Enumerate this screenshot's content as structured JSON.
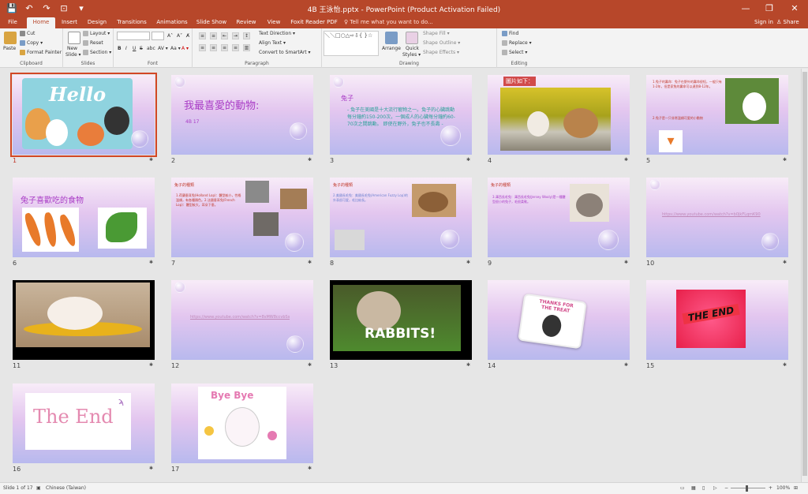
{
  "titlebar": {
    "title": "4B 王泳怡.pptx - PowerPoint (Product Activation Failed)",
    "save": "💾",
    "undo": "↶",
    "redo": "↷",
    "present": "⊡",
    "customize": "▾",
    "minimize": "—",
    "restore": "❐",
    "close": "✕"
  },
  "tabs": [
    "File",
    "Home",
    "Insert",
    "Design",
    "Transitions",
    "Animations",
    "Slide Show",
    "Review",
    "View",
    "Foxit Reader PDF"
  ],
  "tellme": "♀ Tell me what you want to do...",
  "signin": "Sign in",
  "share": "♙ Share",
  "ribbon": {
    "clipboard": {
      "label": "Clipboard",
      "paste": "Paste",
      "cut": "Cut",
      "copy": "Copy ▾",
      "format_painter": "Format Painter"
    },
    "slides": {
      "label": "Slides",
      "new_slide": "New",
      "new_slide2": "Slide ▾",
      "layout": "Layout ▾",
      "reset": "Reset",
      "section": "Section ▾"
    },
    "font": {
      "label": "Font",
      "grow": "A˄",
      "shrink": "A˅",
      "clear": "A̸",
      "bold": "B",
      "italic": "I",
      "underline": "U",
      "strike": "S",
      "shadow": "abc",
      "spacing": "AV ▾",
      "case": "Aa ▾",
      "color": "A ▾"
    },
    "paragraph": {
      "label": "Paragraph",
      "text_direction": "Text Direction ▾",
      "align_text": "Align Text ▾",
      "smartart": "Convert to SmartArt ▾"
    },
    "drawing": {
      "label": "Drawing",
      "arrange": "Arrange",
      "quick_styles": "Quick",
      "quick_styles2": "Styles ▾",
      "shape_fill": "Shape Fill ▾",
      "shape_outline": "Shape Outline ▾",
      "shape_effects": "Shape Effects ▾"
    },
    "editing": {
      "label": "Editing",
      "find": "Find",
      "replace": "Replace ▾",
      "select": "Select ▾"
    }
  },
  "slides": [
    {
      "num": "1",
      "title": "Hello"
    },
    {
      "num": "2",
      "title": "我最喜愛的動物:",
      "sub": "4B 17"
    },
    {
      "num": "3",
      "title": "兔子",
      "body": "- 兔子在美國是十大流行寵物之一。兔子的心臟跳動每分鐘約150-200次，一個成人的心臟每分鐘約60-70次之間跳動。 即使在野外，兔子也不長壽 -"
    },
    {
      "num": "4",
      "title": "圖片如下："
    },
    {
      "num": "5",
      "body": "1.兔子的壽命：兔子在野外的壽命很短，一般只有1-2年，但是家兔的壽命可以達到8-12年。",
      "body2": "2.兔子是一只非常溫順可愛的小動物"
    },
    {
      "num": "6",
      "title": "兔子喜歡吃的食物"
    },
    {
      "num": "7",
      "title": "兔子的種類",
      "body": "1.荷蘭垂耳兔(Holland Lop)：體型較小，性格溫順，有各種顏色。2.法國垂耳兔(French Lop)：體型較大，耳朵下垂。"
    },
    {
      "num": "8",
      "title": "兔子的種類",
      "body": "2.美國長毛兔：美國長毛兔(American Fuzzy Lop)的外表很可愛，毛比較長。"
    },
    {
      "num": "9",
      "title": "兔子的種類",
      "body": "3.澤西長毛兔：澤西長毛兔(Jersey Wooly)是一種體型很小的兔子，毛很柔軟。"
    },
    {
      "num": "10",
      "link": "https://www.youtube.com/watch?v=b0jkFLqmK90"
    },
    {
      "num": "11"
    },
    {
      "num": "12",
      "link": "https://www.youtube.com/watch?v=8sMW8ccvbSs"
    },
    {
      "num": "13",
      "title": "RABBITS!"
    },
    {
      "num": "14",
      "title": "THANKS FOR THE TREAT"
    },
    {
      "num": "15",
      "title": "THE END"
    },
    {
      "num": "16",
      "title": "The End"
    },
    {
      "num": "17",
      "title": "Bye Bye"
    }
  ],
  "status": {
    "slide": "Slide 1 of 17",
    "language": "Chinese (Taiwan)",
    "zoom": "100%"
  }
}
